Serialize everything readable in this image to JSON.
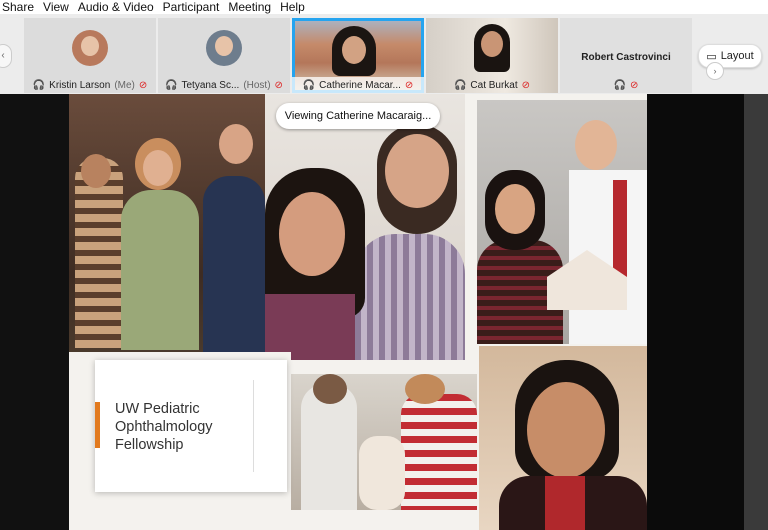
{
  "menu": [
    "Share",
    "View",
    "Audio & Video",
    "Participant",
    "Meeting",
    "Help"
  ],
  "participants": [
    {
      "name": "Kristin Larson",
      "tag": "(Me)"
    },
    {
      "name": "Tetyana Sc...",
      "tag": "(Host)"
    },
    {
      "name": "Catherine Macar...",
      "tag": ""
    },
    {
      "name": "Cat Burkat",
      "tag": ""
    },
    {
      "name": "Robert Castrovinci",
      "tag": ""
    }
  ],
  "layout_label": "Layout",
  "viewing_label": "Viewing Catherine Macaraig...",
  "slide_title": [
    "UW Pediatric",
    "Ophthalmology",
    "Fellowship"
  ],
  "colors": {
    "active_border": "#25a4ef",
    "accent_bar": "#e27a1f",
    "mic_off": "#dd2222"
  }
}
